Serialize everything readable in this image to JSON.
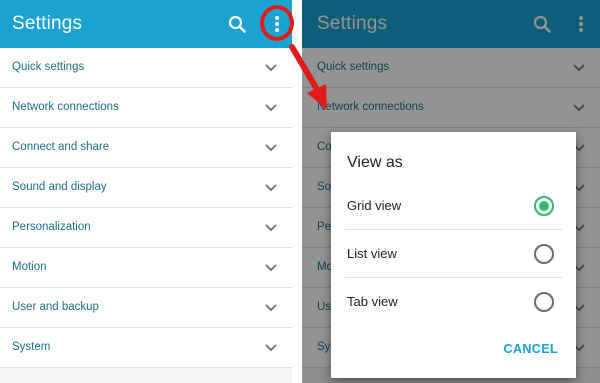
{
  "left_screen": {
    "title": "Settings",
    "icons": {
      "search": "search-icon",
      "more": "more-vert-icon"
    },
    "items": [
      {
        "label": "Quick settings"
      },
      {
        "label": "Network connections"
      },
      {
        "label": "Connect and share"
      },
      {
        "label": "Sound and display"
      },
      {
        "label": "Personalization"
      },
      {
        "label": "Motion"
      },
      {
        "label": "User and backup"
      },
      {
        "label": "System"
      }
    ]
  },
  "right_screen": {
    "title": "Settings",
    "items": [
      {
        "label": "Quick settings"
      },
      {
        "label": "Network connections"
      },
      {
        "label": "Co"
      },
      {
        "label": "So"
      },
      {
        "label": "Pe"
      },
      {
        "label": "Mo"
      },
      {
        "label": "Us"
      },
      {
        "label": "Sy"
      }
    ]
  },
  "dialog": {
    "title": "View as",
    "options": [
      {
        "label": "Grid view",
        "selected": true
      },
      {
        "label": "List view",
        "selected": false
      },
      {
        "label": "Tab view",
        "selected": false
      }
    ],
    "cancel_label": "CANCEL"
  },
  "colors": {
    "appbar": "#1aa3d0",
    "accent_text": "#1a6f8a",
    "radio_selected": "#34b76f",
    "annotation": "#e11b1b"
  }
}
